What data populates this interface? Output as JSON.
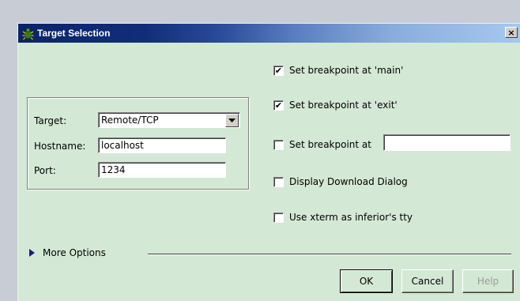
{
  "window": {
    "title": "Target Selection",
    "close_label": "×"
  },
  "target_group": {
    "target_label": "Target:",
    "target_value": "Remote/TCP",
    "hostname_label": "Hostname:",
    "hostname_value": "localhost",
    "port_label": "Port:",
    "port_value": "1234"
  },
  "options": {
    "bp_main": {
      "label": "Set breakpoint at 'main'",
      "checked": true
    },
    "bp_exit": {
      "label": "Set breakpoint at 'exit'",
      "checked": true
    },
    "bp_at": {
      "label": "Set breakpoint at",
      "checked": false,
      "value": ""
    },
    "download_dialog": {
      "label": "Display Download Dialog",
      "checked": false
    },
    "xterm": {
      "label": "Use xterm as inferior's tty",
      "checked": false
    }
  },
  "more_options": {
    "label": "More Options"
  },
  "buttons": {
    "ok": "OK",
    "cancel": "Cancel",
    "help": "Help"
  },
  "icons": {
    "app": "bug-icon",
    "dropdown": "down-arrow-icon",
    "check": "checkmark-icon",
    "expand": "triangle-right-icon"
  }
}
